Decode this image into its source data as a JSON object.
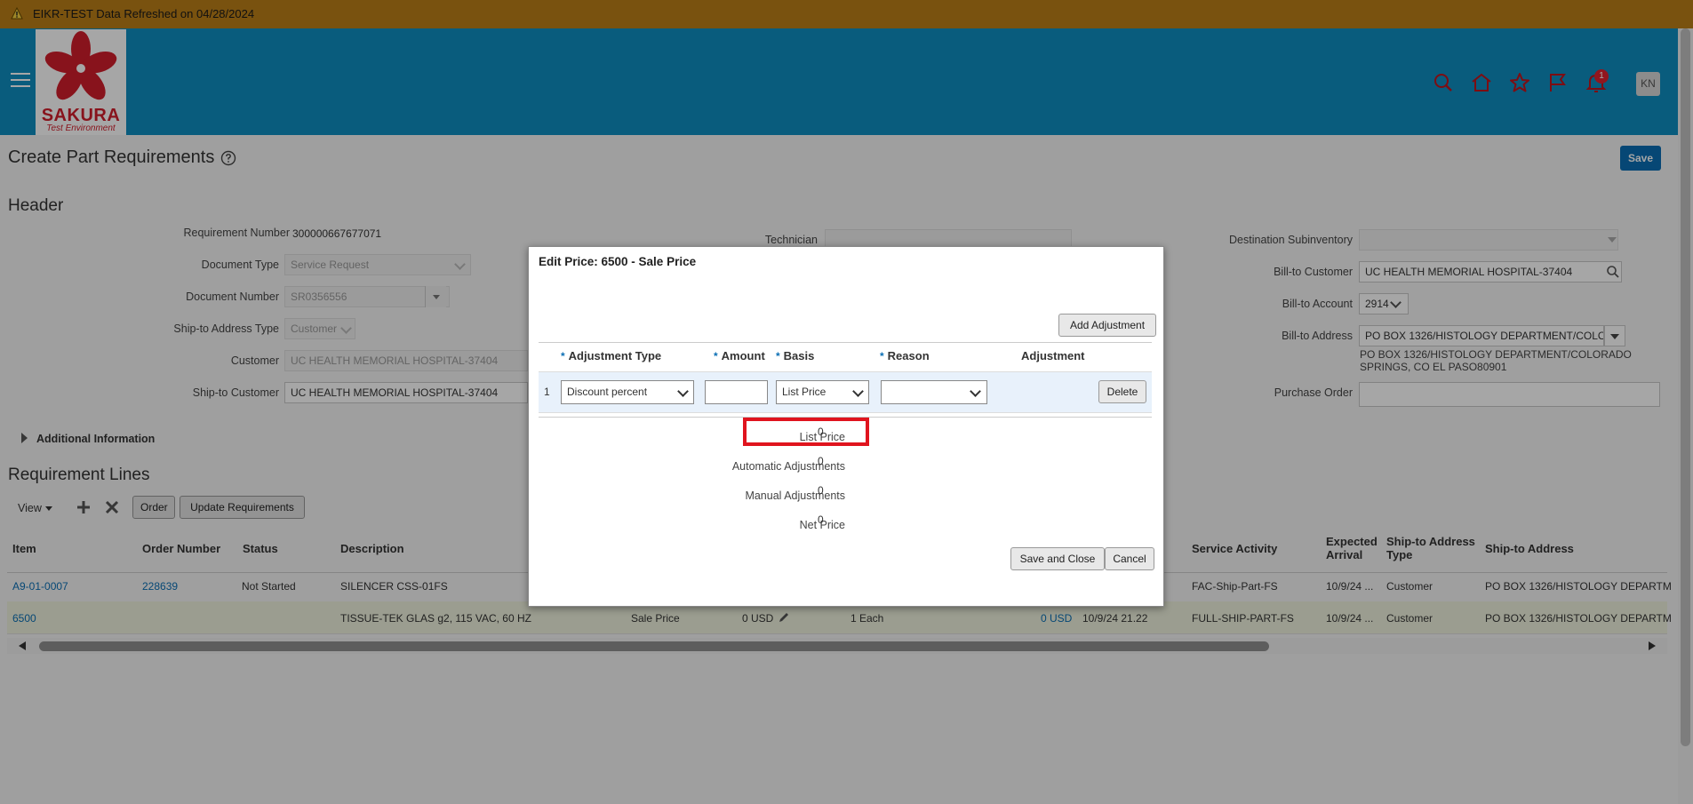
{
  "banner": {
    "text": "EIKR-TEST Data Refreshed on 04/28/2024"
  },
  "logo": {
    "brand": "SAKURA",
    "subtitle": "Test Environment"
  },
  "notifications": {
    "count": "1"
  },
  "user": {
    "initials": "KN"
  },
  "page": {
    "title": "Create Part Requirements",
    "save_label": "Save"
  },
  "header": {
    "section_title": "Header",
    "requirement_number_label": "Requirement Number",
    "requirement_number": "300000667677071",
    "document_type_label": "Document Type",
    "document_type": "Service Request",
    "document_number_label": "Document Number",
    "document_number": "SR0356556",
    "ship_to_address_type_label": "Ship-to Address Type",
    "ship_to_address_type": "Customer",
    "customer_label": "Customer",
    "customer": "UC HEALTH MEMORIAL HOSPITAL-37404",
    "ship_to_customer_label": "Ship-to Customer",
    "ship_to_customer": "UC HEALTH MEMORIAL HOSPITAL-37404",
    "technician_label": "Technician",
    "technician": "",
    "destination_subinventory_label": "Destination Subinventory",
    "destination_subinventory": "",
    "bill_to_customer_label": "Bill-to Customer",
    "bill_to_customer": "UC HEALTH MEMORIAL HOSPITAL-37404",
    "bill_to_account_label": "Bill-to Account",
    "bill_to_account": "2914",
    "bill_to_address_label": "Bill-to Address",
    "bill_to_address_field": "PO BOX 1326/HISTOLOGY DEPARTMENT/COLO",
    "bill_to_address_line1": "PO BOX 1326/HISTOLOGY DEPARTMENT/COLORADO",
    "bill_to_address_line2": "SPRINGS, CO EL PASO80901",
    "purchase_order_label": "Purchase Order",
    "purchase_order": ""
  },
  "additional_info_label": "Additional Information",
  "lines": {
    "section_title": "Requirement Lines",
    "view_label": "View",
    "order_label": "Order",
    "update_label": "Update Requirements",
    "columns": {
      "item": "Item",
      "order_number": "Order Number",
      "status": "Status",
      "description": "Description",
      "service_activity": "Service Activity",
      "expected_arrival_1": "Expected",
      "expected_arrival_2": "Arrival",
      "ship_to_address_type_1": "Ship-to Address",
      "ship_to_address_type_2": "Type",
      "ship_to_address": "Ship-to Address"
    },
    "rows": [
      {
        "item": "A9-01-0007",
        "order_number": "228639",
        "status": "Not Started",
        "description": "SILENCER CSS-01FS",
        "price_type": "",
        "unit_price": "",
        "quantity": "",
        "total": "",
        "date": "",
        "service_activity": "FAC-Ship-Part-FS",
        "expected_arrival": "10/9/24 ...",
        "addr_type": "Customer",
        "address": "PO BOX 1326/HISTOLOGY DEPARTM"
      },
      {
        "item": "6500",
        "order_number": "",
        "status": "",
        "description": "TISSUE-TEK GLAS g2, 115 VAC, 60 HZ",
        "price_type": "Sale Price",
        "unit_price": "0 USD",
        "quantity": "1 Each",
        "total": "0 USD",
        "date": "10/9/24 21.22",
        "service_activity": "FULL-SHIP-PART-FS",
        "expected_arrival": "10/9/24 ...",
        "addr_type": "Customer",
        "address": "PO BOX 1326/HISTOLOGY DEPARTM"
      }
    ]
  },
  "dialog": {
    "title": "Edit Price: 6500 - Sale Price",
    "add_adjustment_label": "Add Adjustment",
    "columns": {
      "adjustment_type": "Adjustment Type",
      "amount": "Amount",
      "basis": "Basis",
      "reason": "Reason",
      "adjustment": "Adjustment"
    },
    "row": {
      "index": "1",
      "adjustment_type": "Discount percent",
      "amount": "",
      "basis": "List Price",
      "reason": "",
      "delete_label": "Delete"
    },
    "summary": {
      "list_price_label": "List Price",
      "list_price": "0",
      "automatic_label": "Automatic Adjustments",
      "automatic": "0",
      "manual_label": "Manual Adjustments",
      "manual": "0",
      "net_price_label": "Net Price",
      "net_price": "0"
    },
    "save_close_label": "Save and Close",
    "cancel_label": "Cancel"
  }
}
